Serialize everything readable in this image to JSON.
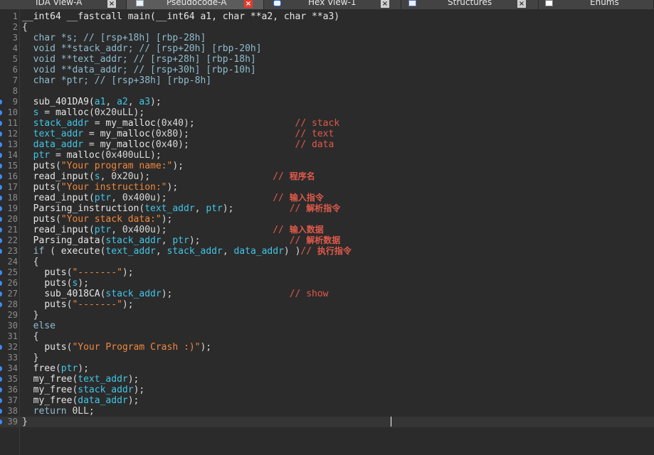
{
  "tabs": [
    {
      "label": "IDA View-A",
      "icon": "",
      "active": false
    },
    {
      "label": "Pseudocode-A",
      "icon": "document-icon",
      "active": true
    },
    {
      "label": "Hex View-1",
      "icon": "hex-view-icon",
      "active": false
    },
    {
      "label": "Structures",
      "icon": "structures-icon",
      "active": false
    },
    {
      "label": "Enums",
      "icon": "enums-icon",
      "active": false
    }
  ],
  "code": {
    "current_line": 39,
    "breakpoint_lines": [
      9,
      10,
      11,
      12,
      13,
      14,
      15,
      16,
      17,
      18,
      19,
      20,
      21,
      22,
      23,
      25,
      26,
      27,
      28,
      32,
      34,
      35,
      36,
      37,
      38,
      39
    ],
    "lines": [
      [
        [
          "fn",
          "__int64 __fastcall main(__int64 a1, char **a2, char **a3)"
        ]
      ],
      [
        [
          "p",
          "{"
        ]
      ],
      [
        [
          "p",
          "  "
        ],
        [
          "ty",
          "char *s; // [rsp+18h] [rbp-28h]"
        ]
      ],
      [
        [
          "p",
          "  "
        ],
        [
          "ty",
          "void **stack_addr; // [rsp+20h] [rbp-20h]"
        ]
      ],
      [
        [
          "p",
          "  "
        ],
        [
          "ty",
          "void **text_addr; // [rsp+28h] [rbp-18h]"
        ]
      ],
      [
        [
          "p",
          "  "
        ],
        [
          "ty",
          "void **data_addr; // [rsp+30h] [rbp-10h]"
        ]
      ],
      [
        [
          "p",
          "  "
        ],
        [
          "ty",
          "char *ptr; // [rsp+38h] [rbp-8h]"
        ]
      ],
      [],
      [
        [
          "p",
          "  "
        ],
        [
          "fn",
          "sub_401DA9("
        ],
        [
          "var",
          "a1"
        ],
        [
          "p",
          ", "
        ],
        [
          "var",
          "a2"
        ],
        [
          "p",
          ", "
        ],
        [
          "var",
          "a3"
        ],
        [
          "p",
          ");"
        ]
      ],
      [
        [
          "p",
          "  "
        ],
        [
          "var",
          "s"
        ],
        [
          "p",
          " = "
        ],
        [
          "fn",
          "malloc"
        ],
        [
          "p",
          "(0x20uLL);"
        ]
      ],
      [
        [
          "p",
          "  "
        ],
        [
          "var",
          "stack_addr"
        ],
        [
          "p",
          " = "
        ],
        [
          "fn",
          "my_malloc"
        ],
        [
          "p",
          "(0x40);                  "
        ],
        [
          "cm",
          "// stack"
        ]
      ],
      [
        [
          "p",
          "  "
        ],
        [
          "var",
          "text_addr"
        ],
        [
          "p",
          " = "
        ],
        [
          "fn",
          "my_malloc"
        ],
        [
          "p",
          "(0x80);                   "
        ],
        [
          "cm",
          "// text"
        ]
      ],
      [
        [
          "p",
          "  "
        ],
        [
          "var",
          "data_addr"
        ],
        [
          "p",
          " = "
        ],
        [
          "fn",
          "my_malloc"
        ],
        [
          "p",
          "(0x40);                   "
        ],
        [
          "cm",
          "// data"
        ]
      ],
      [
        [
          "p",
          "  "
        ],
        [
          "var",
          "ptr"
        ],
        [
          "p",
          " = "
        ],
        [
          "fn",
          "malloc"
        ],
        [
          "p",
          "(0x400uLL);"
        ]
      ],
      [
        [
          "p",
          "  "
        ],
        [
          "fn",
          "puts"
        ],
        [
          "p",
          "("
        ],
        [
          "str",
          "\"Your program name:\""
        ],
        [
          "p",
          ");"
        ]
      ],
      [
        [
          "p",
          "  "
        ],
        [
          "fn",
          "read_input"
        ],
        [
          "p",
          "("
        ],
        [
          "var",
          "s"
        ],
        [
          "p",
          ", 0x20u);                      "
        ],
        [
          "cm",
          "// "
        ],
        [
          "cmz",
          "程序名"
        ]
      ],
      [
        [
          "p",
          "  "
        ],
        [
          "fn",
          "puts"
        ],
        [
          "p",
          "("
        ],
        [
          "str",
          "\"Your instruction:\""
        ],
        [
          "p",
          ");"
        ]
      ],
      [
        [
          "p",
          "  "
        ],
        [
          "fn",
          "read_input"
        ],
        [
          "p",
          "("
        ],
        [
          "var",
          "ptr"
        ],
        [
          "p",
          ", 0x400u);                   "
        ],
        [
          "cm",
          "// "
        ],
        [
          "cmz",
          "输入指令"
        ]
      ],
      [
        [
          "p",
          "  "
        ],
        [
          "fn",
          "Parsing_instruction"
        ],
        [
          "p",
          "("
        ],
        [
          "var",
          "text_addr"
        ],
        [
          "p",
          ", "
        ],
        [
          "var",
          "ptr"
        ],
        [
          "p",
          ");          "
        ],
        [
          "cm",
          "// "
        ],
        [
          "cmz",
          "解析指令"
        ]
      ],
      [
        [
          "p",
          "  "
        ],
        [
          "fn",
          "puts"
        ],
        [
          "p",
          "("
        ],
        [
          "str",
          "\"Your stack data:\""
        ],
        [
          "p",
          ");"
        ]
      ],
      [
        [
          "p",
          "  "
        ],
        [
          "fn",
          "read_input"
        ],
        [
          "p",
          "("
        ],
        [
          "var",
          "ptr"
        ],
        [
          "p",
          ", 0x400u);                   "
        ],
        [
          "cm",
          "// "
        ],
        [
          "cmz",
          "输入数据"
        ]
      ],
      [
        [
          "p",
          "  "
        ],
        [
          "fn",
          "Parsing_data"
        ],
        [
          "p",
          "("
        ],
        [
          "var",
          "stack_addr"
        ],
        [
          "p",
          ", "
        ],
        [
          "var",
          "ptr"
        ],
        [
          "p",
          ");                "
        ],
        [
          "cm",
          "// "
        ],
        [
          "cmz",
          "解析数据"
        ]
      ],
      [
        [
          "p",
          "  "
        ],
        [
          "kw",
          "if"
        ],
        [
          "p",
          " ( "
        ],
        [
          "fn",
          "execute"
        ],
        [
          "p",
          "("
        ],
        [
          "var",
          "text_addr"
        ],
        [
          "p",
          ", "
        ],
        [
          "var",
          "stack_addr"
        ],
        [
          "p",
          ", "
        ],
        [
          "var",
          "data_addr"
        ],
        [
          "p",
          ") )"
        ],
        [
          "cm",
          "// "
        ],
        [
          "cmz",
          "执行指令"
        ]
      ],
      [
        [
          "p",
          "  {"
        ]
      ],
      [
        [
          "p",
          "    "
        ],
        [
          "fn",
          "puts"
        ],
        [
          "p",
          "("
        ],
        [
          "str",
          "\"-------\""
        ],
        [
          "p",
          ");"
        ]
      ],
      [
        [
          "p",
          "    "
        ],
        [
          "fn",
          "puts"
        ],
        [
          "p",
          "("
        ],
        [
          "var",
          "s"
        ],
        [
          "p",
          ");"
        ]
      ],
      [
        [
          "p",
          "    "
        ],
        [
          "fn",
          "sub_4018CA"
        ],
        [
          "p",
          "("
        ],
        [
          "var",
          "stack_addr"
        ],
        [
          "p",
          ");                     "
        ],
        [
          "cm",
          "// show"
        ]
      ],
      [
        [
          "p",
          "    "
        ],
        [
          "fn",
          "puts"
        ],
        [
          "p",
          "("
        ],
        [
          "str",
          "\"-------\""
        ],
        [
          "p",
          ");"
        ]
      ],
      [
        [
          "p",
          "  }"
        ]
      ],
      [
        [
          "p",
          "  "
        ],
        [
          "kw",
          "else"
        ]
      ],
      [
        [
          "p",
          "  {"
        ]
      ],
      [
        [
          "p",
          "    "
        ],
        [
          "fn",
          "puts"
        ],
        [
          "p",
          "("
        ],
        [
          "str",
          "\"Your Program Crash :)\""
        ],
        [
          "p",
          ");"
        ]
      ],
      [
        [
          "p",
          "  }"
        ]
      ],
      [
        [
          "p",
          "  "
        ],
        [
          "fn",
          "free"
        ],
        [
          "p",
          "("
        ],
        [
          "var",
          "ptr"
        ],
        [
          "p",
          ");"
        ]
      ],
      [
        [
          "p",
          "  "
        ],
        [
          "fn",
          "my_free"
        ],
        [
          "p",
          "("
        ],
        [
          "var",
          "text_addr"
        ],
        [
          "p",
          ");"
        ]
      ],
      [
        [
          "p",
          "  "
        ],
        [
          "fn",
          "my_free"
        ],
        [
          "p",
          "("
        ],
        [
          "var",
          "stack_addr"
        ],
        [
          "p",
          ");"
        ]
      ],
      [
        [
          "p",
          "  "
        ],
        [
          "fn",
          "my_free"
        ],
        [
          "p",
          "("
        ],
        [
          "var",
          "data_addr"
        ],
        [
          "p",
          ");"
        ]
      ],
      [
        [
          "p",
          "  "
        ],
        [
          "kw",
          "return"
        ],
        [
          "p",
          " 0LL;"
        ]
      ],
      [
        [
          "p",
          "}"
        ]
      ]
    ]
  }
}
